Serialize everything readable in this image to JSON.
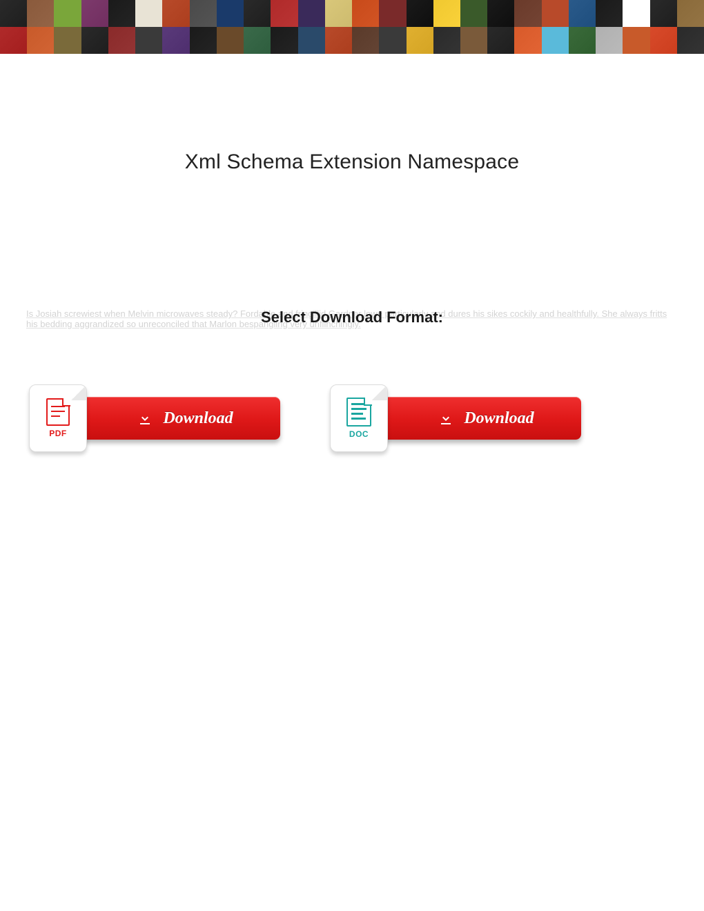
{
  "title": "Xml Schema Extension Namespace",
  "subtitle": "Select Download Format:",
  "ghost_text": "Is Josiah screwiest when Melvin microwaves steady? Fordable and fringillid Gardner lowe particularly and dures his sikes cockily and healthfully. She always fritts his bedding aggrandized so unreconciled that Marlon bespangling very unflinchingly.",
  "buttons": [
    {
      "ext": "PDF",
      "label": "Download",
      "ext_class": "ext-pdf"
    },
    {
      "ext": "DOC",
      "label": "Download",
      "ext_class": "ext-doc"
    }
  ],
  "banner_colors_row1": [
    "#2a2a2a",
    "#8a5a3c",
    "#7aa63a",
    "#7d3a6c",
    "#1a1a1a",
    "#e8e3d5",
    "#b84a2a",
    "#4a4a4a",
    "#1a3a6a",
    "#2a2a2a",
    "#b02a2a",
    "#3a2a5a",
    "#d9c77a",
    "#c84a1a",
    "#7a2a2a",
    "#1a1a1a",
    "#f0c830",
    "#3a5a2a",
    "#1a1a1a",
    "#6a3a2a",
    "#b84a2a",
    "#2a5a8a",
    "#1a1a1a",
    "#ffffff",
    "#2a2a2a",
    "#8a6a3a"
  ],
  "banner_colors_row2": [
    "#b02a2a",
    "#c85a2a",
    "#7a6a3a",
    "#2a2a2a",
    "#8a2a2a",
    "#3a3a3a",
    "#5a3a7a",
    "#1a1a1a",
    "#6a4a2a",
    "#3a6a4a",
    "#1a1a1a",
    "#2a4a6a",
    "#b84a2a",
    "#5a3a2a",
    "#3a3a3a",
    "#e0b030",
    "#2a2a2a",
    "#7a5a3a",
    "#2a2a2a",
    "#d85a2a",
    "#5abada",
    "#3a6a3a",
    "#b0b0b0",
    "#c85a2a",
    "#d84a2a",
    "#2a2a2a"
  ]
}
